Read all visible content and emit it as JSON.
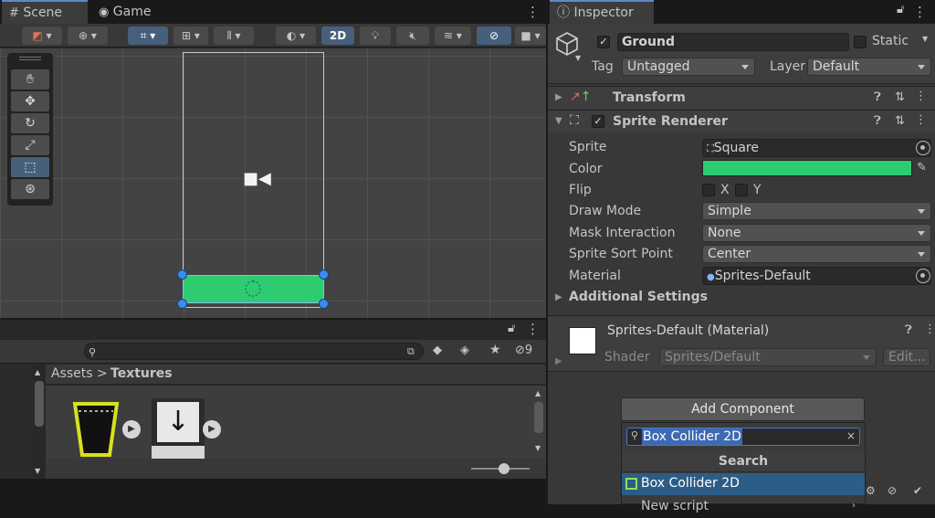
{
  "scene_tabs": {
    "scene": "Scene",
    "game": "Game"
  },
  "scene_toolbar": {
    "mode_2d": "2D"
  },
  "project": {
    "search_placeholder": "",
    "hidden_count": "9",
    "breadcrumb_root": "Assets",
    "breadcrumb_sep": ">",
    "breadcrumb_current": "Textures"
  },
  "inspector": {
    "tab": "Inspector",
    "object_name": "Ground",
    "static_label": "Static",
    "tag_label": "Tag",
    "tag_value": "Untagged",
    "layer_label": "Layer",
    "layer_value": "Default",
    "transform_title": "Transform",
    "sprite_renderer_title": "Sprite Renderer",
    "color_value": "#2ecc71",
    "props": {
      "sprite_label": "Sprite",
      "sprite_value": "Square",
      "color_label": "Color",
      "flip_label": "Flip",
      "flip_x": "X",
      "flip_y": "Y",
      "draw_mode_label": "Draw Mode",
      "draw_mode_value": "Simple",
      "mask_label": "Mask Interaction",
      "mask_value": "None",
      "sort_label": "Sprite Sort Point",
      "sort_value": "Center",
      "material_label": "Material",
      "material_value": "Sprites-Default"
    },
    "additional_settings": "Additional Settings",
    "material_title": "Sprites-Default (Material)",
    "shader_label": "Shader",
    "shader_value": "Sprites/Default",
    "edit_button": "Edit...",
    "add_component": "Add Component"
  },
  "popup": {
    "search_value": "Box Collider 2D",
    "header": "Search",
    "results": [
      "Box Collider 2D",
      "New script"
    ]
  }
}
